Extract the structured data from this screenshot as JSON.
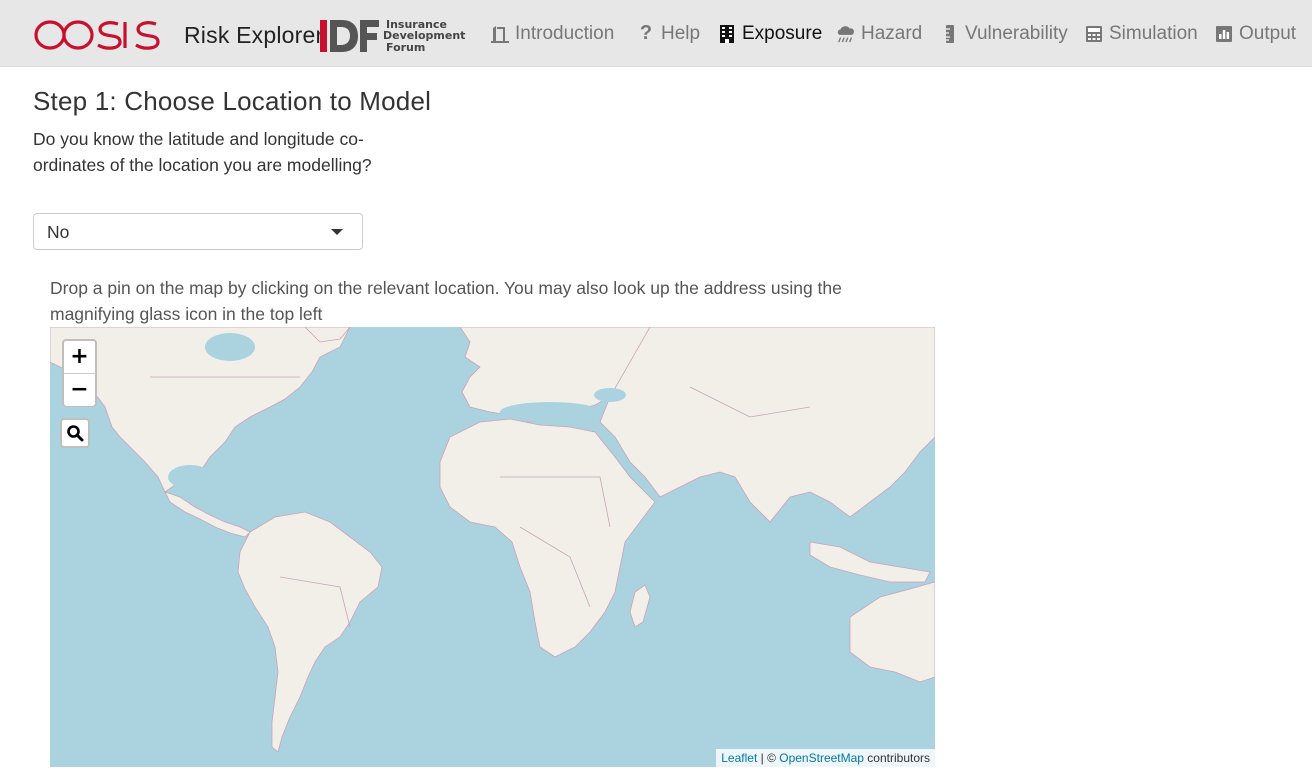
{
  "brand": {
    "logo_text": "OASIS",
    "app_name": "Risk Explorer",
    "partner_logo": "IDF",
    "partner_lines": [
      "Insurance",
      "Development",
      "Forum"
    ]
  },
  "nav": [
    {
      "label": "Introduction",
      "icon": "door-icon",
      "active": false
    },
    {
      "label": "Help",
      "icon": "question-icon",
      "active": false
    },
    {
      "label": "Exposure",
      "icon": "building-icon",
      "active": true
    },
    {
      "label": "Hazard",
      "icon": "cloud-rain-icon",
      "active": false
    },
    {
      "label": "Vulnerability",
      "icon": "ruler-icon",
      "active": false
    },
    {
      "label": "Simulation",
      "icon": "calculator-icon",
      "active": false
    },
    {
      "label": "Output",
      "icon": "bar-chart-icon",
      "active": false
    }
  ],
  "step": {
    "title": "Step 1: Choose Location to Model",
    "question": "Do you know the latitude and longitude co-ordinates of the location you are modelling?",
    "select_value": "No",
    "instructions": "Drop a pin on the map by clicking on the relevant location. You may also look up the address using the magnifying glass icon in the top left"
  },
  "map": {
    "zoom_in": "+",
    "zoom_out": "−",
    "attribution": {
      "leaflet": "Leaflet",
      "separator": " | © ",
      "osm": "OpenStreetMap",
      "suffix": " contributors"
    },
    "colors": {
      "water": "#aad3df",
      "land": "#f2efe9",
      "border": "#c9a3b8"
    }
  }
}
